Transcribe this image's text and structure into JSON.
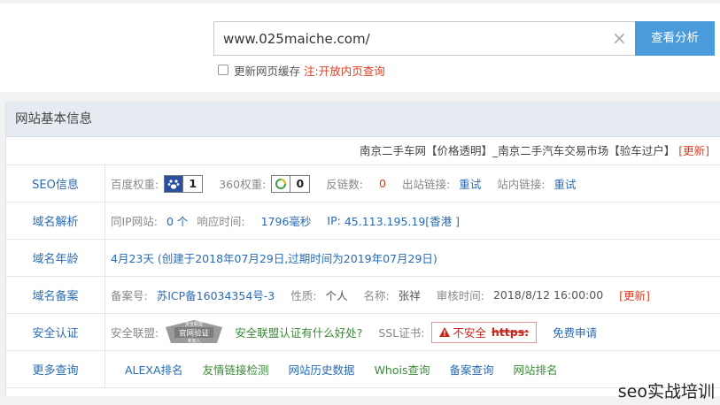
{
  "search": {
    "value": "www.025maiche.com/",
    "clear_icon": "close-icon",
    "button_label": "查看分析",
    "refresh_label": "更新网页缓存",
    "note_prefix": "注:",
    "note_link": "开放内页查询"
  },
  "panel": {
    "title": "网站基本信息",
    "site_title": "南京二手车网【价格透明】_南京二手汽车交易市场【验车过户】",
    "update_label": "[更新]"
  },
  "seo": {
    "label": "SEO信息",
    "baidu_label": "百度权重:",
    "baidu_value": "1",
    "so360_label": "360权重:",
    "so360_value": "0",
    "backlinks_label": "反链数:",
    "backlinks_value": "0",
    "outlinks_label": "出站链接:",
    "outlinks_value": "重试",
    "inlinks_label": "站内链接:",
    "inlinks_value": "重试"
  },
  "dns": {
    "label": "域名解析",
    "same_ip_label": "同IP网站:",
    "same_ip_value": "0 个",
    "response_label": "响应时间:",
    "response_value": "1796毫秒",
    "ip_label": "IP:",
    "ip_value": "45.113.195.19[香港 ]"
  },
  "age": {
    "label": "域名年龄",
    "value": "4月23天 (创建于2018年07月29日,过期时间为2019年07月29日)"
  },
  "icp": {
    "label": "域名备案",
    "num_label": "备案号:",
    "num_value": "苏ICP备16034354号-3",
    "nature_label": "性质:",
    "nature_value": "个人",
    "name_label": "名称:",
    "name_value": "张祥",
    "audit_label": "审核时间:",
    "audit_value": "2018/8/12 16:00:00",
    "update_label": "[更新]"
  },
  "security": {
    "label": "安全认证",
    "alliance_label": "安全联盟:",
    "seal_top": "安全联盟",
    "seal_main": "官网验证",
    "seal_bottom": "未加入",
    "alliance_link": "安全联盟认证有什么好处?",
    "ssl_label": "SSL证书:",
    "ssl_warning": "不安全",
    "ssl_https": "https:",
    "ssl_apply": "免费申请"
  },
  "more": {
    "label": "更多查询",
    "links": [
      "ALEXA排名",
      "友情链接检测",
      "网站历史数据",
      "Whois查询",
      "备案查询",
      "网站排名"
    ]
  },
  "watermark": "seo实战培训",
  "colors": {
    "accent": "#4a9bdc",
    "link": "#2a6bb5",
    "danger": "#e03a1e",
    "green_link": "#3a8a3a",
    "header_bg": "#e6eaf1"
  }
}
